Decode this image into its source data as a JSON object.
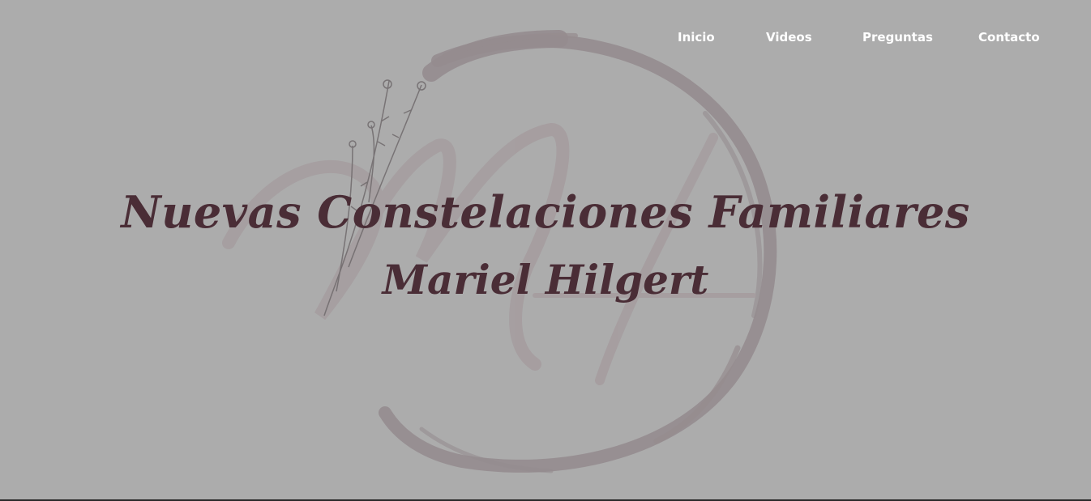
{
  "nav": {
    "items": [
      {
        "label": "Inicio"
      },
      {
        "label": "Videos"
      },
      {
        "label": "Preguntas"
      },
      {
        "label": "Contacto"
      }
    ]
  },
  "hero": {
    "title": "Nuevas Constelaciones Familiares",
    "subtitle": "Mariel Hilgert",
    "logo_monogram": "MH"
  },
  "colors": {
    "background": "#acacac",
    "heading": "#4a2d36",
    "nav_text": "#ffffff",
    "logo_stroke": "#958c8f"
  }
}
